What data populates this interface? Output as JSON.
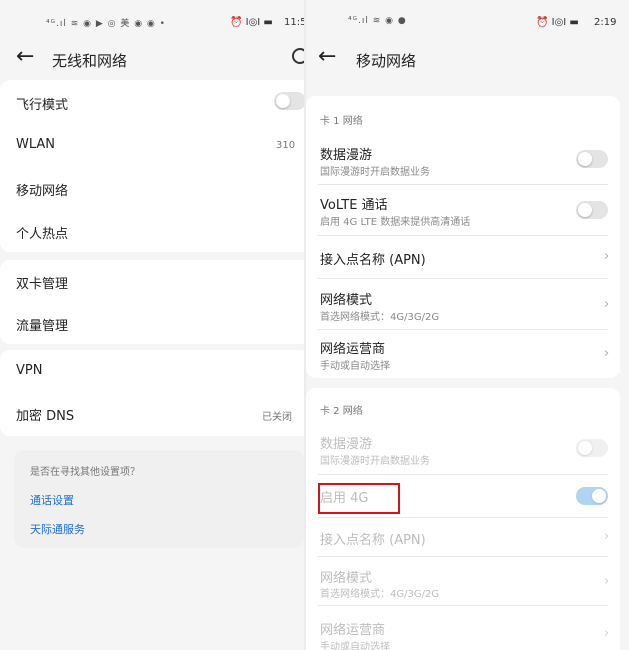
{
  "left": {
    "status": {
      "signal": "⁴ᴳ.ıl ≋ ◉ ▶ ◎ 美 ◉ ◉ •",
      "system": "⏰ I◎I ▬",
      "time": "11:5"
    },
    "title": "无线和网络",
    "items": [
      {
        "label": "飞行模式",
        "switch": false
      },
      {
        "label": "WLAN",
        "value": "310"
      },
      {
        "label": "移动网络"
      },
      {
        "label": "个人热点"
      },
      {
        "label": "双卡管理"
      },
      {
        "label": "流量管理"
      },
      {
        "label": "VPN"
      },
      {
        "label": "加密 DNS",
        "value": "已关闭"
      }
    ],
    "tip": {
      "question": "是否在寻找其他设置项？",
      "links": [
        "通话设置",
        "天际通服务"
      ]
    }
  },
  "right": {
    "status": {
      "signal": "⁴ᴳ.ıl ≋ ◉ ●",
      "system": "⏰ I◎I ▬",
      "time": "2:19"
    },
    "title": "移动网络",
    "card1": {
      "header": "卡 1 网络",
      "items": [
        {
          "label": "数据漫游",
          "sub": "国际漫游时开启数据业务",
          "switch": false
        },
        {
          "label": "VoLTE 通话",
          "sub": "启用 4G LTE 数据来提供高清通话",
          "switch": false
        },
        {
          "label": "接入点名称 (APN)"
        },
        {
          "label": "网络模式",
          "sub": "首选网络模式：4G/3G/2G"
        },
        {
          "label": "网络运营商",
          "sub": "手动或自动选择"
        }
      ]
    },
    "card2": {
      "header": "卡 2 网络",
      "items": [
        {
          "label": "数据漫游",
          "sub": "国际漫游时开启数据业务",
          "switch": false
        },
        {
          "label": "启用 4G",
          "switch": true
        },
        {
          "label": "接入点名称 (APN)"
        },
        {
          "label": "网络模式",
          "sub": "首选网络模式：4G/3G/2G"
        },
        {
          "label": "网络运营商",
          "sub": "手动或自动选择"
        }
      ]
    }
  },
  "colors": {
    "accent": "#1d6fd1",
    "switch_on": "#6fb3e8",
    "highlight": "#d4141b"
  },
  "icons": {
    "back": "back-arrow-icon",
    "search": "search-icon",
    "chevron": "chevron-right-icon"
  }
}
